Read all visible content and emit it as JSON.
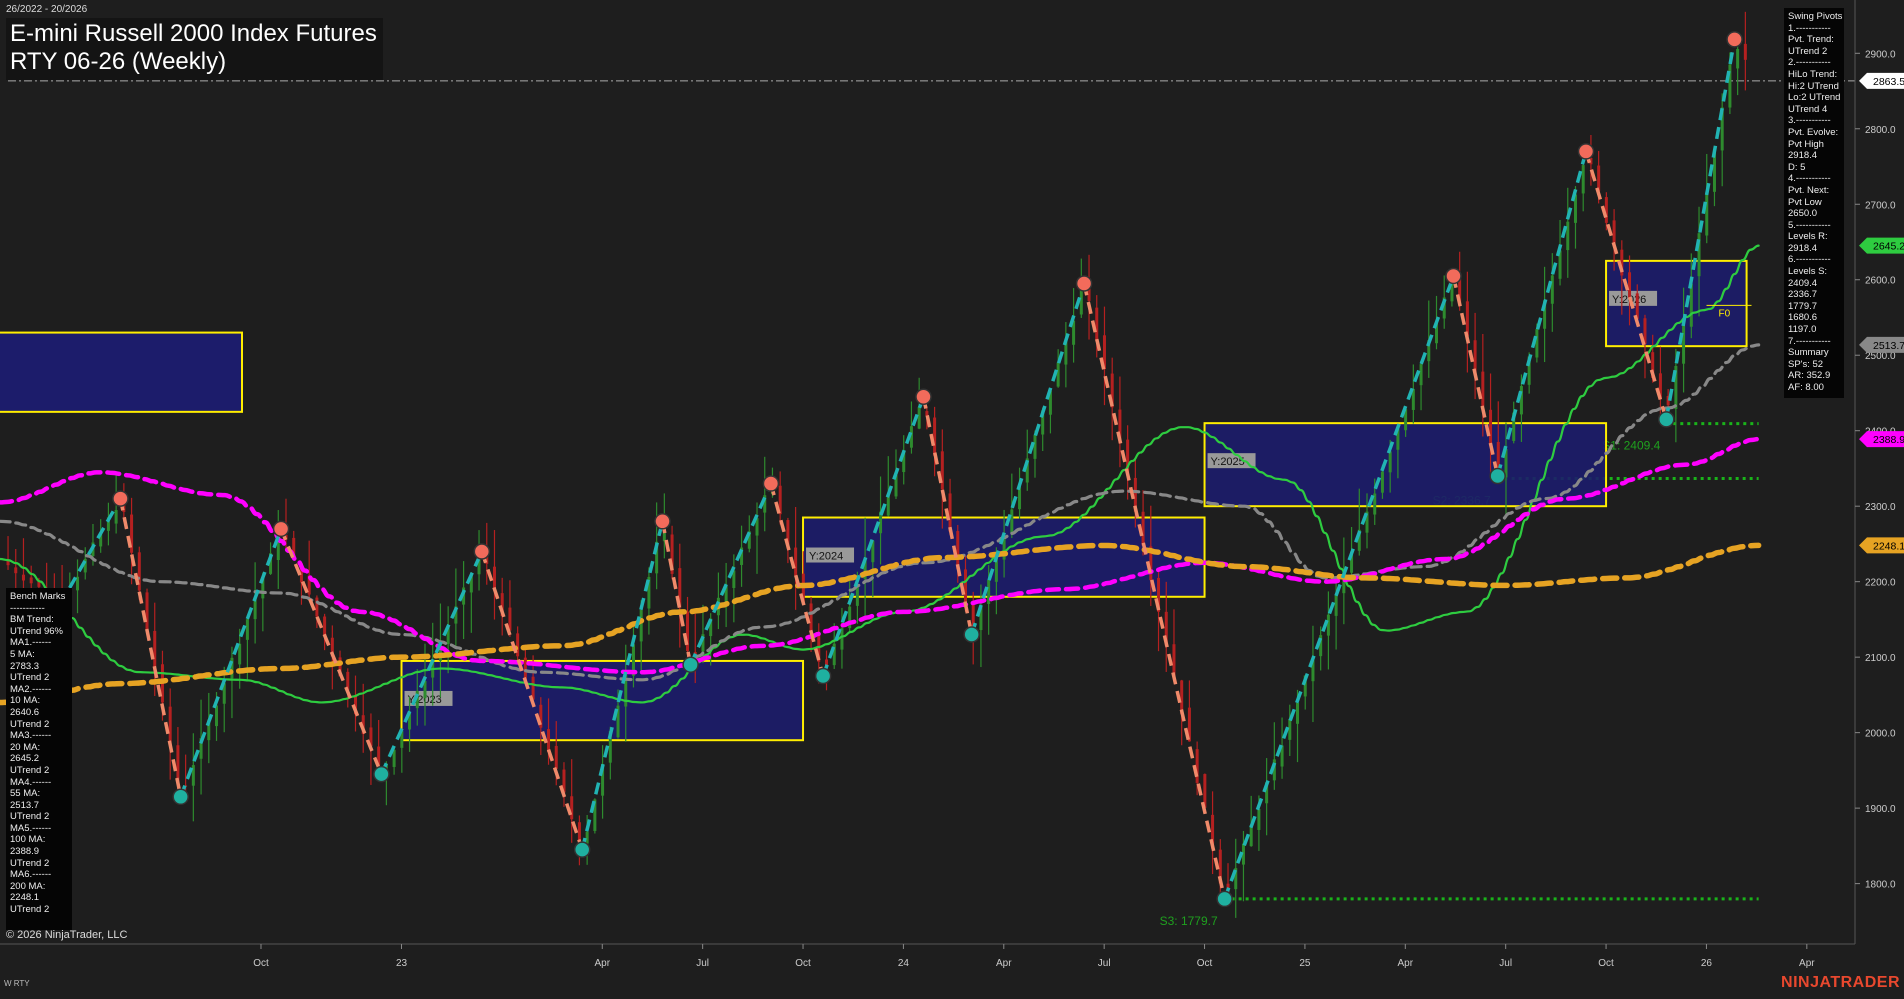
{
  "header": {
    "date_range": "26/2022 - 20/2026",
    "title_line1": "E-mini Russell 2000 Index Futures",
    "title_line2": "RTY 06-26 (Weekly)"
  },
  "footer": {
    "copyright": "© 2026 NinjaTrader, LLC",
    "instrument": "W RTY",
    "brand": "NINJATRADER"
  },
  "swing_pivots_panel": [
    "Swing Pivots",
    "1.-----------",
    "Pvt. Trend:",
    "UTrend 2",
    "2.-----------",
    "HiLo Trend:",
    "Hi:2 UTrend",
    "Lo:2 UTrend",
    "UTrend 4",
    "3.-----------",
    "Pvt. Evolve:",
    "Pvt High",
    "2918.4",
    "D: 5",
    "4.-----------",
    "Pvt. Next:",
    "Pvt Low",
    "2650.0",
    "5.-----------",
    "Levels R:",
    "2918.4",
    "6.-----------",
    "Levels S:",
    "2409.4",
    "2336.7",
    "1779.7",
    "1680.6",
    "1197.0",
    "7.-----------",
    "Summary",
    "SP's: 52",
    "AR: 352.9",
    "AF: 8.00"
  ],
  "benchmarks_panel": [
    "Bench Marks",
    "-----------",
    "BM Trend:",
    "UTrend 96%",
    "MA1.------",
    "5 MA:",
    "2783.3",
    "UTrend 2",
    "MA2.------",
    "10 MA:",
    "2640.6",
    "UTrend 2",
    "MA3.------",
    "20 MA:",
    "2645.2",
    "UTrend 2",
    "MA4.------",
    "55 MA:",
    "2513.7",
    "UTrend 2",
    "MA5.------",
    "100 MA:",
    "2388.9",
    "UTrend 2",
    "MA6.------",
    "200 MA:",
    "2248.1",
    "UTrend 2"
  ],
  "chart_data": {
    "type": "candlestick",
    "timeframe": "Weekly",
    "ylim": [
      1720,
      2960
    ],
    "y_ticks": [
      1800,
      1900,
      2000,
      2100,
      2200,
      2300,
      2400,
      2500,
      2600,
      2700,
      2800,
      2900
    ],
    "x_ticks": [
      {
        "label": "Oct",
        "t": 0.65
      },
      {
        "label": "23",
        "t": 1.0
      },
      {
        "label": "Apr",
        "t": 1.5
      },
      {
        "label": "Jul",
        "t": 1.75
      },
      {
        "label": "Oct",
        "t": 2.0
      },
      {
        "label": "24",
        "t": 2.25
      },
      {
        "label": "Apr",
        "t": 2.5
      },
      {
        "label": "Jul",
        "t": 2.75
      },
      {
        "label": "Oct",
        "t": 3.0
      },
      {
        "label": "25",
        "t": 3.25
      },
      {
        "label": "Apr",
        "t": 3.5
      },
      {
        "label": "Jul",
        "t": 3.75
      },
      {
        "label": "Oct",
        "t": 4.0
      },
      {
        "label": "26",
        "t": 4.25
      },
      {
        "label": "Apr",
        "t": 4.5
      }
    ],
    "current_price": 2863.5,
    "price_tags": [
      {
        "value": 2863.5,
        "label": "2863.5",
        "color": "#ffffff",
        "text_color": "#000000"
      },
      {
        "value": 2645.2,
        "label": "2645.2",
        "color": "#2ecc40",
        "text_color": "#000000"
      },
      {
        "value": 2513.7,
        "label": "2513.7",
        "color": "#888888",
        "text_color": "#000000"
      },
      {
        "value": 2388.9,
        "label": "2388.9",
        "color": "#ff00ff",
        "text_color": "#000000"
      },
      {
        "value": 2248.1,
        "label": "2248.1",
        "color": "#e6a323",
        "text_color": "#000000"
      }
    ],
    "swing_pivots": [
      {
        "t": 0.15,
        "price": 2170,
        "type": "low"
      },
      {
        "t": 0.3,
        "price": 2310,
        "type": "high"
      },
      {
        "t": 0.45,
        "price": 1915,
        "type": "low"
      },
      {
        "t": 0.7,
        "price": 2270,
        "type": "high"
      },
      {
        "t": 0.95,
        "price": 1945,
        "type": "low"
      },
      {
        "t": 1.2,
        "price": 2240,
        "type": "high"
      },
      {
        "t": 1.45,
        "price": 1845,
        "type": "low"
      },
      {
        "t": 1.65,
        "price": 2280,
        "type": "high"
      },
      {
        "t": 1.72,
        "price": 2090,
        "type": "low"
      },
      {
        "t": 1.92,
        "price": 2330,
        "type": "high"
      },
      {
        "t": 2.05,
        "price": 2075,
        "type": "low"
      },
      {
        "t": 2.3,
        "price": 2445,
        "type": "high"
      },
      {
        "t": 2.42,
        "price": 2130,
        "type": "low"
      },
      {
        "t": 2.7,
        "price": 2595,
        "type": "high"
      },
      {
        "t": 3.05,
        "price": 1779.7,
        "type": "low"
      },
      {
        "t": 3.62,
        "price": 2605,
        "type": "high"
      },
      {
        "t": 3.73,
        "price": 2340,
        "type": "low"
      },
      {
        "t": 3.95,
        "price": 2770,
        "type": "high"
      },
      {
        "t": 4.15,
        "price": 2415,
        "type": "low"
      },
      {
        "t": 4.32,
        "price": 2918.4,
        "type": "high"
      }
    ],
    "yearly_boxes": [
      {
        "label": "Y:2023",
        "t0": 1.0,
        "t1": 2.0,
        "low": 1990,
        "high": 2095
      },
      {
        "label": "Y:2024",
        "t0": 2.0,
        "t1": 3.0,
        "low": 2180,
        "high": 2285
      },
      {
        "label": "Y:2025",
        "t0": 3.0,
        "t1": 4.0,
        "low": 2300,
        "high": 2410
      },
      {
        "label": "Y:2026",
        "t0": 4.0,
        "t1": 4.35,
        "low": 2512,
        "high": 2625
      }
    ],
    "support_levels": [
      {
        "label": "S1: 2409.4",
        "value": 2409.4
      },
      {
        "label": "S2: 2336.7",
        "value": 2336.7
      },
      {
        "label": "S3: 1779.7",
        "value": 1779.7
      }
    ],
    "moving_averages": [
      {
        "period": 20,
        "value": 2645.2,
        "color": "#2ecc40"
      },
      {
        "period": 55,
        "value": 2513.7,
        "color": "#888888"
      },
      {
        "period": 100,
        "value": 2388.9,
        "color": "#ff00ff"
      },
      {
        "period": 200,
        "value": 2248.1,
        "color": "#e6a323"
      }
    ],
    "markers": [
      {
        "label": "F0",
        "t": 4.3,
        "price": 2558
      }
    ]
  }
}
